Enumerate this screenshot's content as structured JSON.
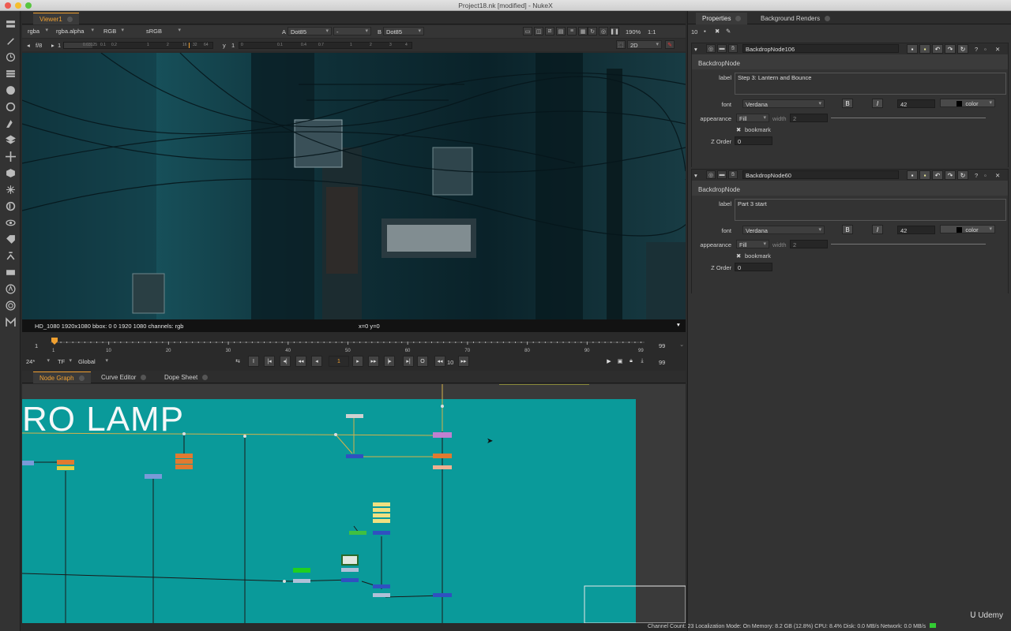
{
  "window": {
    "title": "Project18.nk [modified] - NukeX"
  },
  "viewer_tab": {
    "label": "Viewer1"
  },
  "viewer_toolbar": {
    "channels": "rgba",
    "alpha": "rgba.alpha",
    "rgb": "RGB",
    "colorspace": "sRGB",
    "a_label": "A",
    "a_input": "Dot85",
    "dash": "-",
    "b_label": "B",
    "b_input": "Dot85",
    "fstop": "f/8",
    "gain_value": "1",
    "y_label": "y",
    "gamma_value": "1",
    "zoom": "190%",
    "ratio": "1:1",
    "view_mode": "2D",
    "gain_ticks": [
      "0.03125",
      "0.1",
      "0.2",
      "1",
      "2",
      "16",
      "32",
      "64"
    ],
    "gamma_ticks": [
      "0",
      "0.1",
      "0.4",
      "0.7",
      "1",
      "2",
      "3",
      "4"
    ]
  },
  "viewer_info": {
    "format": "HD_1080 1920x1080  bbox: 0 0 1920 1080 channels: rgb",
    "coords": "x=0 y=0"
  },
  "timeline": {
    "start": "1",
    "end": "99",
    "end2": "99",
    "ticks": [
      "1",
      "10",
      "20",
      "30",
      "40",
      "50",
      "60",
      "70",
      "80",
      "90",
      "99"
    ],
    "fps": "24*",
    "tf": "TF",
    "scope": "Global",
    "current_frame": "1",
    "step": "10"
  },
  "graph_tabs": [
    {
      "label": "Node Graph"
    },
    {
      "label": "Curve Editor"
    },
    {
      "label": "Dope Sheet"
    }
  ],
  "nodegraph": {
    "backdrop_label": "RO LAMP"
  },
  "props_tabs": [
    {
      "label": "Properties"
    },
    {
      "label": "Background Renders"
    }
  ],
  "props_toolbar": {
    "max_panels": "10"
  },
  "nodes": [
    {
      "name": "BackdropNode106",
      "tab": "BackdropNode",
      "label_caption": "label",
      "label_value": "Step 3: Lantern and Bounce",
      "font_caption": "font",
      "font_value": "Verdana",
      "bold": "B",
      "italic": "I",
      "size": "42",
      "color_label": "color",
      "appearance_caption": "appearance",
      "appearance_value": "Fill",
      "width_caption": "width",
      "width_value": "2",
      "bookmark_label": "bookmark",
      "zorder_caption": "Z Order",
      "zorder_value": "0"
    },
    {
      "name": "BackdropNode60",
      "tab": "BackdropNode",
      "label_caption": "label",
      "label_value": "Part 3 start",
      "font_caption": "font",
      "font_value": "Verdana",
      "bold": "B",
      "italic": "I",
      "size": "42",
      "color_label": "color",
      "appearance_caption": "appearance",
      "appearance_value": "Fill",
      "width_caption": "width",
      "width_value": "2",
      "bookmark_label": "bookmark",
      "zorder_caption": "Z Order",
      "zorder_value": "0"
    }
  ],
  "status": {
    "text": "Channel Count: 23  Localization Mode: On  Memory: 8.2 GB (12.8%)  CPU: 8.4%  Disk: 0.0 MB/s  Network: 0.0 MB/s"
  },
  "watermark": {
    "text": "Udemy"
  },
  "colors": {
    "accent": "#f0a030",
    "backdrop": "#0a9a9a",
    "viewer_bg": "#0e2a33"
  }
}
